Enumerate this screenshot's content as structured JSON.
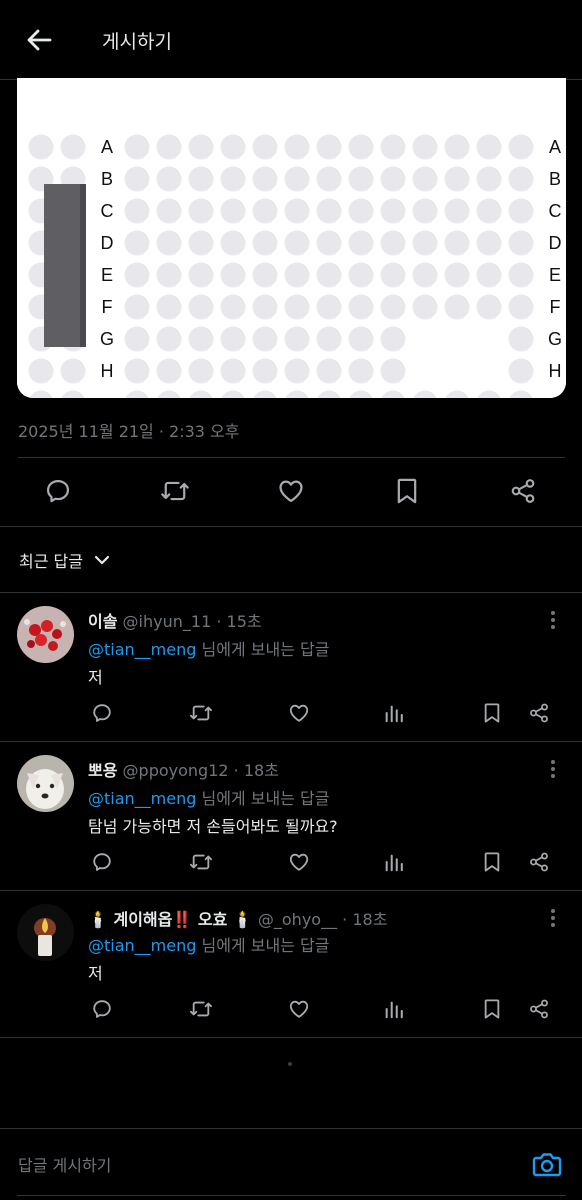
{
  "header": {
    "title": "게시하기"
  },
  "media": {
    "row_labels": [
      "A",
      "B",
      "C",
      "D",
      "E",
      "F",
      "G",
      "H"
    ],
    "background": "#ffffff",
    "well_color": "#e7e7ec",
    "block_color": "#5f5f63"
  },
  "post": {
    "timestamp": "2025년 11월 21일 · 2:33 오후"
  },
  "sort": {
    "label": "최근 답글"
  },
  "replies": [
    {
      "name": "이솔",
      "handle": "@ihyun_11",
      "time": "15초",
      "mention": "@tian__meng",
      "replying_rest": "님에게 보내는 답글",
      "text": "저"
    },
    {
      "name": "뽀용",
      "handle": "@ppoyong12",
      "time": "18초",
      "mention": "@tian__meng",
      "replying_rest": "님에게 보내는 답글",
      "text": "탐넘 가능하면 저 손들어봐도 될까요?"
    },
    {
      "name": "🕯️ 계이해옵‼️ 오효 🕯️",
      "handle": "@_ohyo__",
      "time": "18초",
      "mention": "@tian__meng",
      "replying_rest": "님에게 보내는 답글",
      "text": "저"
    }
  ],
  "compose": {
    "placeholder": "답글 게시하기"
  },
  "icons": {
    "header": [
      "back-arrow-icon"
    ],
    "post_actions": [
      "reply-icon",
      "repost-icon",
      "like-icon",
      "bookmark-icon",
      "share-icon"
    ],
    "reply_actions": [
      "reply-icon",
      "repost-icon",
      "like-icon",
      "views-icon",
      "bookmark-icon",
      "share-icon"
    ],
    "other": [
      "chevron-down-icon",
      "more-icon",
      "camera-icon"
    ]
  },
  "colors": {
    "accent": "#1d9bf0",
    "muted": "#71767b",
    "text": "#e7e9ea",
    "border": "#2f3336"
  }
}
